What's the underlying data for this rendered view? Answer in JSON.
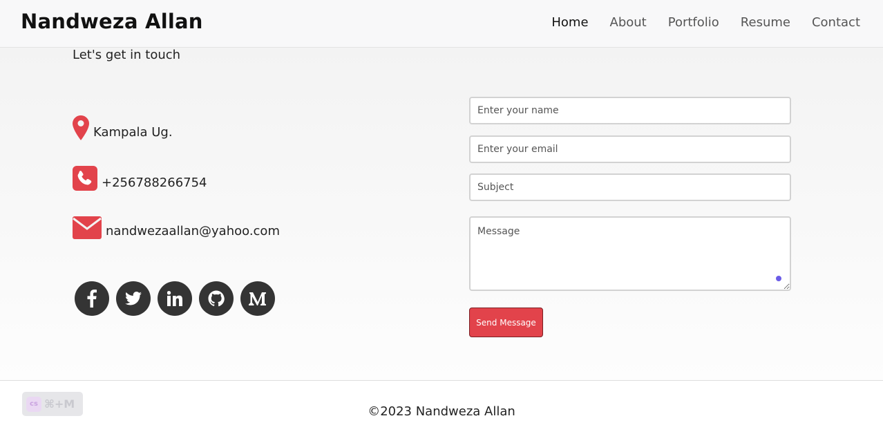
{
  "header": {
    "brand": "Nandweza Allan",
    "nav": [
      {
        "label": "Home",
        "active": true
      },
      {
        "label": "About",
        "active": false
      },
      {
        "label": "Portfolio",
        "active": false
      },
      {
        "label": "Resume",
        "active": false
      },
      {
        "label": "Contact",
        "active": false
      }
    ]
  },
  "contact": {
    "heading": "Let's get in touch",
    "location": "Kampala Ug.",
    "phone": "+256788266754",
    "email": "nandwezaallan@yahoo.com",
    "socials": [
      "facebook-icon",
      "twitter-icon",
      "linkedin-icon",
      "github-icon",
      "medium-icon"
    ]
  },
  "form": {
    "name_placeholder": "Enter your name",
    "email_placeholder": "Enter your email",
    "subject_placeholder": "Subject",
    "message_placeholder": "Message",
    "send_label": "Send Message"
  },
  "footer": {
    "copyright": "©2023 Nandweza Allan",
    "extension_shortcut": "⌘+M",
    "extension_logo_text": "cs"
  },
  "colors": {
    "accent": "#e2434b",
    "icon_red": "#e2434b",
    "social_bg": "#343434"
  }
}
